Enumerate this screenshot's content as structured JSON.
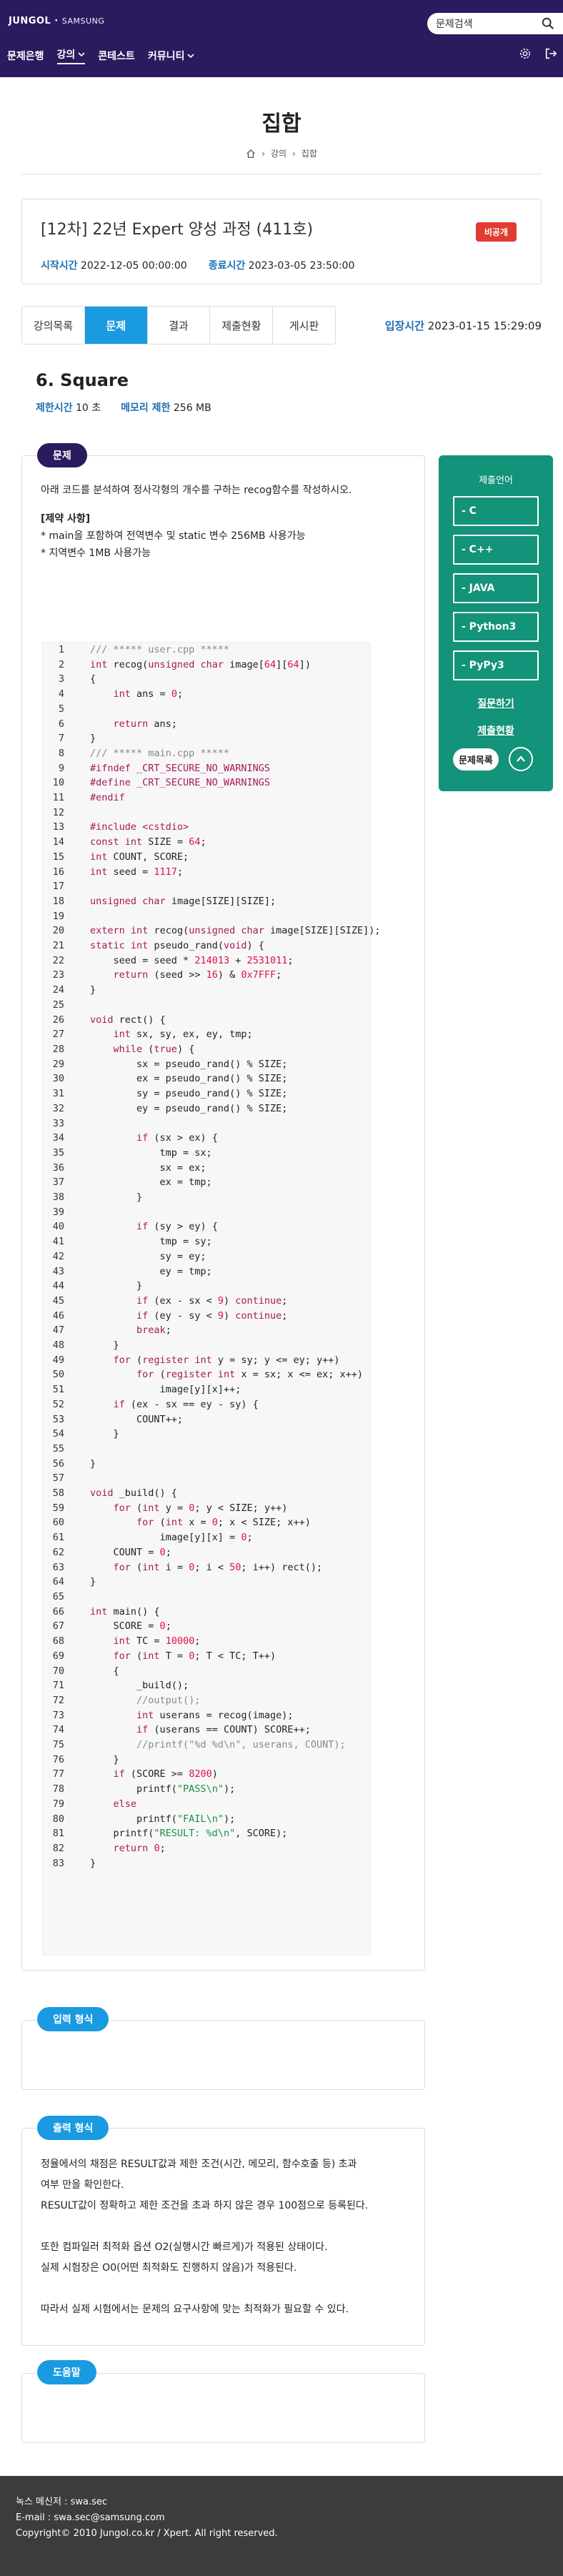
{
  "header": {
    "logo_main": "JUNGOL",
    "logo_sep": " · ",
    "logo_sub": "SAMSUNG",
    "search_placeholder": "문제검색",
    "nav": [
      {
        "label": "문제은행",
        "has_chevron": false
      },
      {
        "label": "강의",
        "has_chevron": true,
        "active": true
      },
      {
        "label": "콘테스트",
        "has_chevron": false
      },
      {
        "label": "커뮤니티",
        "has_chevron": true
      }
    ]
  },
  "page": {
    "title": "집합",
    "breadcrumb": [
      "강의",
      "집합"
    ]
  },
  "contest": {
    "title": "[12차] 22년 Expert 양성 과정 (411호)",
    "badge": "비공개",
    "start_label": "시작시간",
    "start_value": "2022-12-05 00:00:00",
    "end_label": "종료시간",
    "end_value": "2023-03-05 23:50:00"
  },
  "tabs": [
    {
      "label": "강의목록"
    },
    {
      "label": "문제",
      "active": true
    },
    {
      "label": "결과"
    },
    {
      "label": "제출현황"
    },
    {
      "label": "게시판"
    }
  ],
  "entry": {
    "label": "입장시간",
    "value": "2023-01-15 15:29:09"
  },
  "problem": {
    "name": "6. Square",
    "time_label": "제한시간",
    "time_value": "10 초",
    "mem_label": "메모리 제한",
    "mem_value": "256 MB",
    "section_label": "문제",
    "desc": "아래 코드를 분석하여 정사각형의 개수를 구하는 recog함수를 작성하시오.",
    "constraint_title": "[제약 사항]",
    "constraints": [
      "* main을 포함하여 전역변수 및 static 변수 256MB 사용가능",
      "* 지역변수 1MB 사용가능"
    ]
  },
  "submit": {
    "header": "제출언어",
    "languages": [
      "- C",
      "- C++",
      "- JAVA",
      "- Python3",
      "- PyPy3"
    ],
    "question_link": "질문하기",
    "status_link": "제출현황",
    "list_button": "문제목록"
  },
  "input_section": {
    "label": "입력 형식"
  },
  "output_section": {
    "label": "출력 형식",
    "lines": [
      "정율에서의 채점은 RESULT값과 제한 조건(시간, 메모리, 함수호출 등) 초과",
      "여부 만을 확인한다.",
      "RESULT값이 정확하고 제한 조건을 초과 하지 않은 경우 100점으로 등록된다.",
      "",
      "또한 컴파일러 최적화 옵션 O2(실행시간 빠르게)가 적용된 상태이다.",
      "실제 시험장은 O0(어떤 최적화도 진행하지 않음)가 적용된다.",
      "",
      "따라서 실제 시험에서는 문제의 요구사항에 맞는 최적화가 필요할 수 있다."
    ]
  },
  "help_section": {
    "label": "도움말"
  },
  "footer": {
    "line1": "녹스 메신저 : swa.sec",
    "line2": "E-mail : swa.sec@samsung.com",
    "line3": "Copyright© 2010 Jungol.co.kr / Xpert. All right reserved."
  },
  "colors": {
    "header_bg": "#2a1a5e",
    "accent_blue": "#1a9ae0",
    "submit_panel": "#12937a",
    "badge_red": "#e03c31",
    "footer_bg": "#3c3c3c"
  },
  "code": [
    "/// ***** user.cpp *****",
    "int recog(unsigned char image[64][64])",
    "{",
    "    int ans = 0;",
    "",
    "    return ans;",
    "}",
    "/// ***** main.cpp *****",
    "#ifndef _CRT_SECURE_NO_WARNINGS",
    "#define _CRT_SECURE_NO_WARNINGS",
    "#endif",
    "",
    "#include <cstdio>",
    "const int SIZE = 64;",
    "int COUNT, SCORE;",
    "int seed = 1117;",
    "",
    "unsigned char image[SIZE][SIZE];",
    "",
    "extern int recog(unsigned char image[SIZE][SIZE]);",
    "static int pseudo_rand(void) {",
    "    seed = seed * 214013 + 2531011;",
    "    return (seed >> 16) & 0x7FFF;",
    "}",
    "",
    "void rect() {",
    "    int sx, sy, ex, ey, tmp;",
    "    while (true) {",
    "        sx = pseudo_rand() % SIZE;",
    "        ex = pseudo_rand() % SIZE;",
    "        sy = pseudo_rand() % SIZE;",
    "        ey = pseudo_rand() % SIZE;",
    "",
    "        if (sx > ex) {",
    "            tmp = sx;",
    "            sx = ex;",
    "            ex = tmp;",
    "        }",
    "",
    "        if (sy > ey) {",
    "            tmp = sy;",
    "            sy = ey;",
    "            ey = tmp;",
    "        }",
    "        if (ex - sx < 9) continue;",
    "        if (ey - sy < 9) continue;",
    "        break;",
    "    }",
    "    for (register int y = sy; y <= ey; y++)",
    "        for (register int x = sx; x <= ex; x++)",
    "            image[y][x]++;",
    "    if (ex - sx == ey - sy) {",
    "        COUNT++;",
    "    }",
    "",
    "}",
    "",
    "void _build() {",
    "    for (int y = 0; y < SIZE; y++)",
    "        for (int x = 0; x < SIZE; x++)",
    "            image[y][x] = 0;",
    "    COUNT = 0;",
    "    for (int i = 0; i < 50; i++) rect();",
    "}",
    "",
    "int main() {",
    "    SCORE = 0;",
    "    int TC = 10000;",
    "    for (int T = 0; T < TC; T++)",
    "    {",
    "        _build();",
    "        //output();",
    "        int userans = recog(image);",
    "        if (userans == COUNT) SCORE++;",
    "        //printf(\"%d %d\\n\", userans, COUNT);",
    "    }",
    "    if (SCORE >= 8200)",
    "        printf(\"PASS\\n\");",
    "    else",
    "        printf(\"FAIL\\n\");",
    "    printf(\"RESULT: %d\\n\", SCORE);",
    "    return 0;",
    "}"
  ]
}
